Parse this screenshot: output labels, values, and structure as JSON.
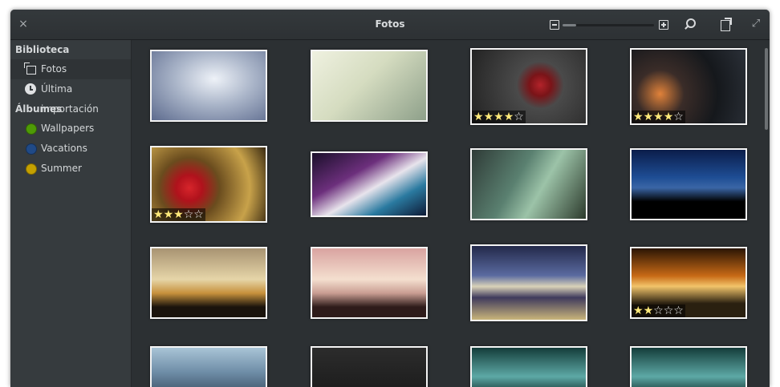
{
  "window": {
    "title": "Fotos",
    "close_icon": "×",
    "maximize_icon": "⤢"
  },
  "toolbar": {
    "zoom_level": 0.15
  },
  "sidebar": {
    "sections": [
      {
        "label": "Biblioteca",
        "items": [
          {
            "label": "Fotos",
            "icon": "photos-icon",
            "selected": true
          },
          {
            "label": "Última importación",
            "icon": "clock-icon",
            "selected": false
          }
        ]
      },
      {
        "label": "Álbumes",
        "items": [
          {
            "label": "Wallpapers",
            "icon": "album-color-dot",
            "color": "#4e9a06"
          },
          {
            "label": "Vacations",
            "icon": "album-color-dot",
            "color": "#204a87"
          },
          {
            "label": "Summer",
            "icon": "album-color-dot",
            "color": "#c4a000"
          }
        ]
      }
    ]
  },
  "photos": [
    {
      "rating": 0
    },
    {
      "rating": 0
    },
    {
      "rating": 4
    },
    {
      "rating": 4
    },
    {
      "rating": 3
    },
    {
      "rating": 0
    },
    {
      "rating": 0
    },
    {
      "rating": 0
    },
    {
      "rating": 0
    },
    {
      "rating": 0
    },
    {
      "rating": 0
    },
    {
      "rating": 2
    },
    {
      "rating": 0
    },
    {
      "rating": 0
    },
    {
      "rating": 0
    },
    {
      "rating": 0
    }
  ]
}
